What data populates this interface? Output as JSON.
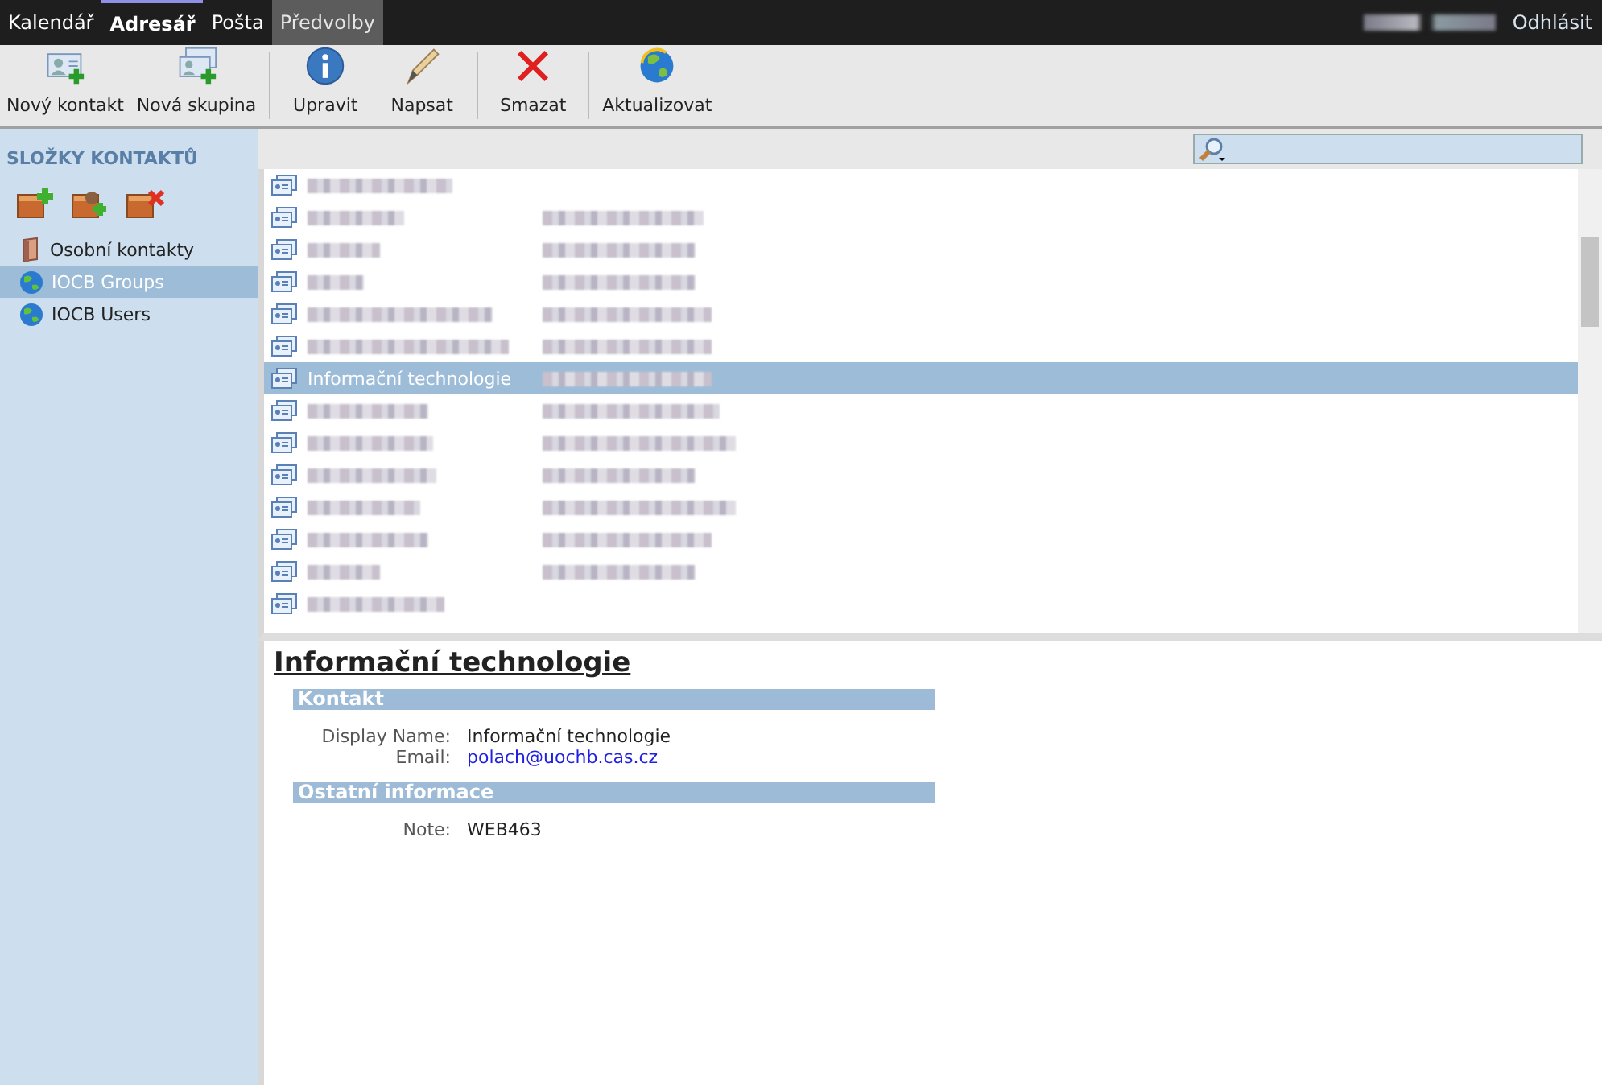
{
  "top_tabs": [
    {
      "label": "Kalendář",
      "selected": false,
      "highlighted": false
    },
    {
      "label": "Adresář",
      "selected": true,
      "highlighted": false
    },
    {
      "label": "Pošta",
      "selected": false,
      "highlighted": false
    },
    {
      "label": "Předvolby",
      "selected": false,
      "highlighted": true
    }
  ],
  "logout": "Odhlásit",
  "toolbar": [
    {
      "kind": "new-contact",
      "label": "Nový kontakt"
    },
    {
      "kind": "new-group",
      "label": "Nová skupina"
    },
    {
      "kind": "separator"
    },
    {
      "kind": "info",
      "label": "Upravit"
    },
    {
      "kind": "pencil",
      "label": "Napsat"
    },
    {
      "kind": "separator"
    },
    {
      "kind": "delete",
      "label": "Smazat"
    },
    {
      "kind": "separator"
    },
    {
      "kind": "refresh",
      "label": "Aktualizovat"
    }
  ],
  "sidebar": {
    "title": "SLOŽKY KONTAKTŮ",
    "folders": [
      {
        "kind": "book",
        "label": "Osobní kontakty",
        "selected": false
      },
      {
        "kind": "globe",
        "label": "IOCB Groups",
        "selected": true
      },
      {
        "kind": "globe",
        "label": "IOCB Users",
        "selected": false
      }
    ]
  },
  "contacts": [
    {
      "selected": false,
      "email": false
    },
    {
      "selected": false,
      "email": true
    },
    {
      "selected": false,
      "email": true
    },
    {
      "selected": false,
      "email": true
    },
    {
      "selected": false,
      "email": true
    },
    {
      "selected": false,
      "email": true
    },
    {
      "selected": true,
      "email": true,
      "name": "Informační technologie"
    },
    {
      "selected": false,
      "email": true
    },
    {
      "selected": false,
      "email": true
    },
    {
      "selected": false,
      "email": true
    },
    {
      "selected": false,
      "email": true
    },
    {
      "selected": false,
      "email": true
    },
    {
      "selected": false,
      "email": true
    },
    {
      "selected": false,
      "email": false
    }
  ],
  "detail": {
    "title": "Informační technologie",
    "sections": [
      {
        "heading": "Kontakt",
        "fields": [
          {
            "label": "Display Name:",
            "value": "Informační technologie",
            "kind": "text"
          },
          {
            "label": "Email:",
            "value": "polach@uochb.cas.cz",
            "kind": "link"
          }
        ]
      },
      {
        "heading": "Ostatní informace",
        "fields": [
          {
            "label": "Note:",
            "value": "WEB463",
            "kind": "text"
          }
        ]
      }
    ]
  }
}
